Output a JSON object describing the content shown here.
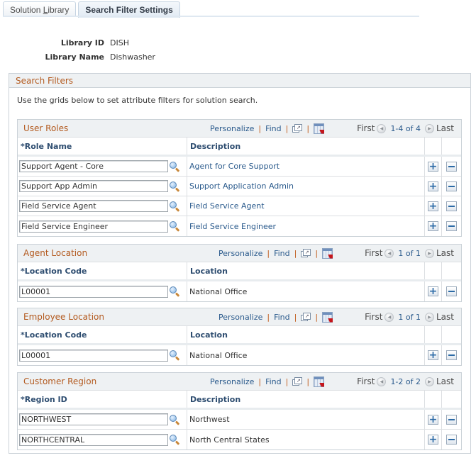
{
  "tabs": [
    {
      "label_pre": "Solution ",
      "label_u": "L",
      "label_post": "ibrary",
      "active": false
    },
    {
      "label": "Search Filter Settings",
      "active": true
    }
  ],
  "library": {
    "id_label": "Library ID",
    "id_value": "DISH",
    "name_label": "Library Name",
    "name_value": "Dishwasher"
  },
  "search_filters": {
    "title": "Search Filters",
    "instructions": "Use the grids below to set attribute filters for solution search.",
    "toolbar": {
      "personalize": "Personalize",
      "find": "Find",
      "first": "First",
      "last": "Last"
    },
    "grids": [
      {
        "title": "User Roles",
        "count": "1-4 of 4",
        "col1": "*Role Name",
        "col2": "Description",
        "col2_link": true,
        "rows": [
          {
            "value": "Support Agent - Core",
            "description": "Agent for Core Support"
          },
          {
            "value": "Support App Admin",
            "description": "Support Application Admin"
          },
          {
            "value": "Field Service Agent",
            "description": "Field Service Agent"
          },
          {
            "value": "Field Service Engineer",
            "description": "Field Service Engineer"
          }
        ]
      },
      {
        "title": "Agent Location",
        "count": "1 of 1",
        "col1": "*Location Code",
        "col2": "Location",
        "col2_link": false,
        "rows": [
          {
            "value": "L00001",
            "description": "National Office"
          }
        ]
      },
      {
        "title": "Employee Location",
        "count": "1 of 1",
        "col1": "*Location Code",
        "col2": "Location",
        "col2_link": false,
        "rows": [
          {
            "value": "L00001",
            "description": "National Office"
          }
        ]
      },
      {
        "title": "Customer Region",
        "count": "1-2 of 2",
        "col1": "*Region ID",
        "col2": "Description",
        "col2_link": false,
        "rows": [
          {
            "value": "NORTHWEST",
            "description": "Northwest"
          },
          {
            "value": "NORTHCENTRAL",
            "description": "North Central States"
          }
        ]
      }
    ]
  },
  "icons": {
    "lookup": "magnifier-lookup-icon",
    "zoom": "new-window-zoom-icon",
    "download": "download-to-excel-icon",
    "prev": "previous-row-icon",
    "next": "next-row-icon",
    "add": "add-row-icon",
    "delete": "delete-row-icon"
  },
  "colors": {
    "section_title": "#b35a1f",
    "link": "#2a5a8c",
    "header_text": "#2e4d70",
    "border": "#cbd2d8"
  }
}
